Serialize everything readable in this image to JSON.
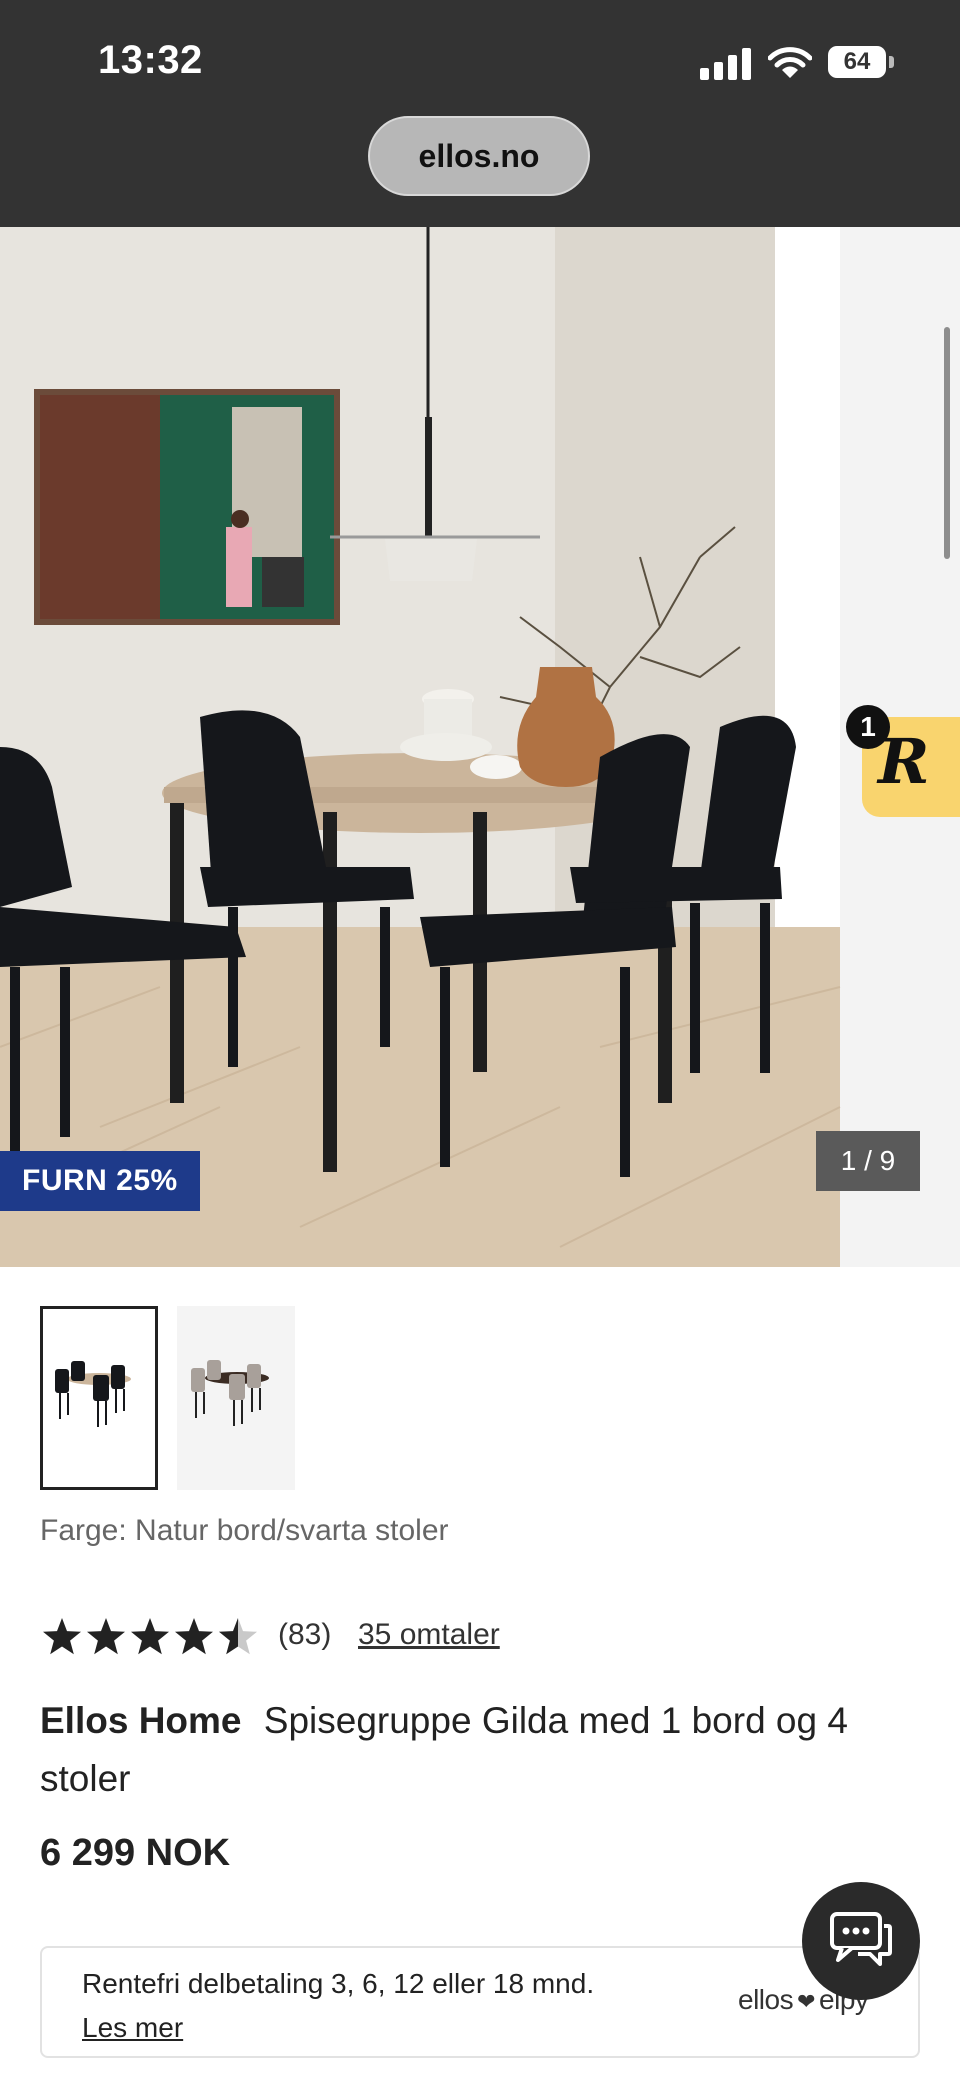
{
  "status_bar": {
    "time": "13:32",
    "battery": "64",
    "icons": [
      "cellular-signal-icon",
      "wifi-icon",
      "battery-icon"
    ]
  },
  "browser": {
    "url": "ellos.no"
  },
  "gallery": {
    "promo_badge": "FURN 25%",
    "counter": "1 / 9",
    "current_image": 1,
    "total_images": 9,
    "thumbnails": [
      "Natur bord/svarta stoler",
      "alternate colour variant"
    ]
  },
  "widget": {
    "letter": "R",
    "notification_count": "1",
    "accent": "#f9d46e"
  },
  "product": {
    "color_label": "Farge: Natur bord/svarta stoler",
    "rating_value": 4.5,
    "rating_count": "(83)",
    "reviews_link": "35 omtaler",
    "brand": "Ellos Home",
    "name": "Spisegruppe Gilda med 1 bord og 4 stoler",
    "price": "6 299 NOK"
  },
  "payment": {
    "text": "Rentefri delbetaling 3, 6, 12 eller 18 mnd.",
    "link": "Les mer",
    "brand_left": "ellos",
    "brand_right": "elpy"
  },
  "chat": {
    "icon": "chat-bubble-icon"
  },
  "colors": {
    "status_bar_bg": "#333333",
    "promo_badge_bg": "#1e3a8a",
    "counter_bg": "#5a5a5a",
    "chat_button_bg": "#2a2a2a"
  }
}
